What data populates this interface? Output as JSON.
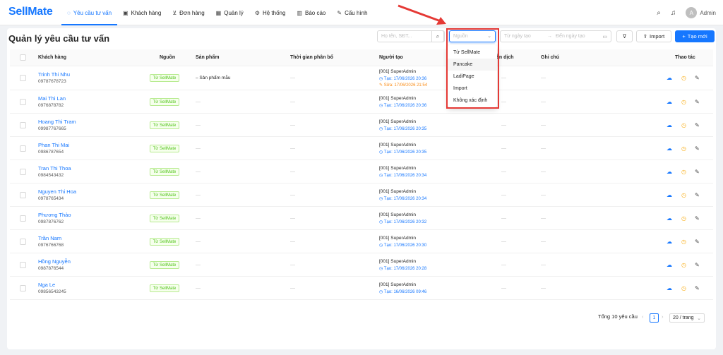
{
  "app": {
    "logo": "SellMate"
  },
  "nav": [
    {
      "label": "Yêu cầu tư vấn",
      "icon": "chat-icon",
      "active": true
    },
    {
      "label": "Khách hàng",
      "icon": "contacts-icon"
    },
    {
      "label": "Đơn hàng",
      "icon": "cart-icon"
    },
    {
      "label": "Quản lý",
      "icon": "grid-icon"
    },
    {
      "label": "Hệ thống",
      "icon": "gear-icon"
    },
    {
      "label": "Báo cáo",
      "icon": "chart-icon"
    },
    {
      "label": "Cấu hình",
      "icon": "wrench-icon"
    }
  ],
  "user": {
    "avatar": "A",
    "name": "Admin"
  },
  "page": {
    "title": "Quản lý yêu cầu tư vấn"
  },
  "toolbar": {
    "search_placeholder": "Họ tên, SĐT...",
    "source_placeholder": "Nguồn",
    "date_from": "Từ ngày tạo",
    "date_to": "Đến ngày tạo",
    "import_label": "Import",
    "create_label": "Tạo mới"
  },
  "table": {
    "columns": {
      "customer": "Khách hàng",
      "source": "Nguồn",
      "product": "Sản phẩm",
      "allocation": "Thời gian phân bổ",
      "creator": "Người tạo",
      "status": "Diễn dịch",
      "note": "Ghi chú",
      "actions": "Thao tác"
    },
    "rows": [
      {
        "name": "Trinh Thi Nhu",
        "phone": "09787678723",
        "source": "Từ SellMate",
        "product": "– Sản phẩm mẫu",
        "creator": "[001] SuperAdmin",
        "created": "Tạo: 17/06/2026 20:36",
        "edited": "Sửa: 17/06/2026 21:54"
      },
      {
        "name": "Mai Thi Lan",
        "phone": "0976878782",
        "source": "Từ SellMate",
        "product": "",
        "creator": "[001] SuperAdmin",
        "created": "Tạo: 17/06/2026 20:36",
        "edited": ""
      },
      {
        "name": "Hoang Thi Tram",
        "phone": "09987767665",
        "source": "Từ SellMate",
        "product": "",
        "creator": "[001] SuperAdmin",
        "created": "Tạo: 17/06/2026 20:35",
        "edited": ""
      },
      {
        "name": "Phan Thi Mai",
        "phone": "0986787654",
        "source": "Từ SellMate",
        "product": "",
        "creator": "[001] SuperAdmin",
        "created": "Tạo: 17/06/2026 20:35",
        "edited": ""
      },
      {
        "name": "Tran Thi Thoa",
        "phone": "0984543432",
        "source": "Từ SellMate",
        "product": "",
        "creator": "[001] SuperAdmin",
        "created": "Tạo: 17/06/2026 20:34",
        "edited": ""
      },
      {
        "name": "Nguyen Thi Hoa",
        "phone": "0978765434",
        "source": "Từ SellMate",
        "product": "",
        "creator": "[001] SuperAdmin",
        "created": "Tạo: 17/06/2026 20:34",
        "edited": ""
      },
      {
        "name": "Phương Thảo",
        "phone": "0987876762",
        "source": "Từ SellMate",
        "product": "",
        "creator": "[001] SuperAdmin",
        "created": "Tạo: 17/06/2026 20:32",
        "edited": ""
      },
      {
        "name": "Trần Nam",
        "phone": "0976766768",
        "source": "Từ SellMate",
        "product": "",
        "creator": "[001] SuperAdmin",
        "created": "Tạo: 17/06/2026 20:30",
        "edited": ""
      },
      {
        "name": "Hồng Nguyễn",
        "phone": "0987876544",
        "source": "Từ SellMate",
        "product": "",
        "creator": "[001] SuperAdmin",
        "created": "Tạo: 17/06/2026 20:28",
        "edited": ""
      },
      {
        "name": "Nga Le",
        "phone": "09856543245",
        "source": "Từ SellMate",
        "product": "",
        "creator": "[001] SuperAdmin",
        "created": "Tạo: 16/06/2026 09:46",
        "edited": ""
      }
    ],
    "empty_dash": "—"
  },
  "dropdown": {
    "options": [
      "Từ SellMate",
      "Pancake",
      "LadiPage",
      "Import",
      "Không xác định"
    ],
    "hovered": "Pancake"
  },
  "pagination": {
    "total": "Tổng 10 yêu cầu",
    "page": "1",
    "page_size": "20 / trang"
  },
  "colors": {
    "primary": "#1677ff",
    "tag_green": "#52c41a",
    "edit_orange": "#fa8c16",
    "highlight_red": "#e53935"
  }
}
